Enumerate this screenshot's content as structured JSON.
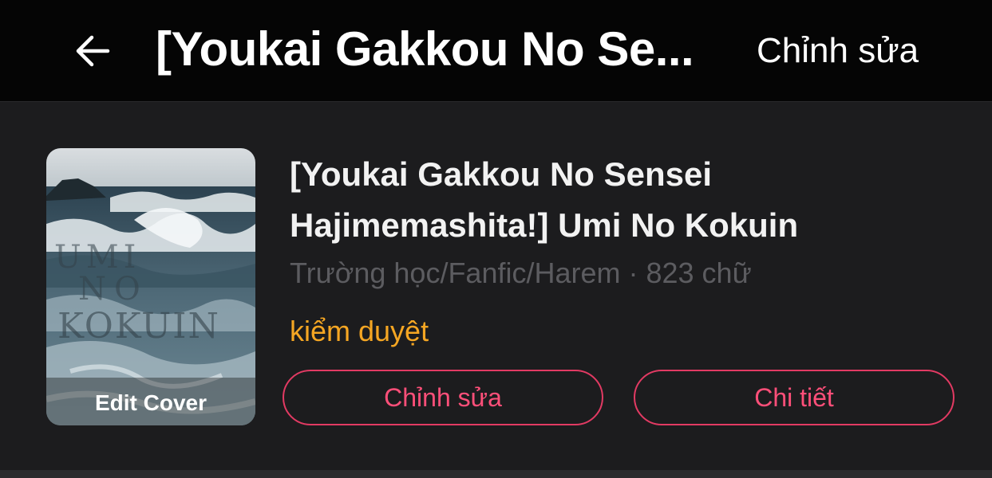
{
  "header": {
    "title": "[Youkai Gakkou No Se...",
    "edit_label": "Chỉnh sửa",
    "back_icon": "arrow-left-icon"
  },
  "story": {
    "title": "[Youkai Gakkou No Sensei Hajimemashita!] Umi No Kokuin",
    "meta": "Trường học/Fanfic/Harem · 823 chữ",
    "status": "kiểm duyệt",
    "cover": {
      "edit_label": "Edit Cover",
      "art_text_line1": "UMI",
      "art_text_line2": "NO",
      "art_text_line3": "KOKUIN"
    }
  },
  "actions": {
    "edit_label": "Chỉnh sửa",
    "detail_label": "Chi tiết"
  },
  "colors": {
    "accent": "#e23a63",
    "status": "#f5a623",
    "background": "#1c1c1e",
    "topbar": "#050505",
    "meta_text": "#5c5c60"
  }
}
